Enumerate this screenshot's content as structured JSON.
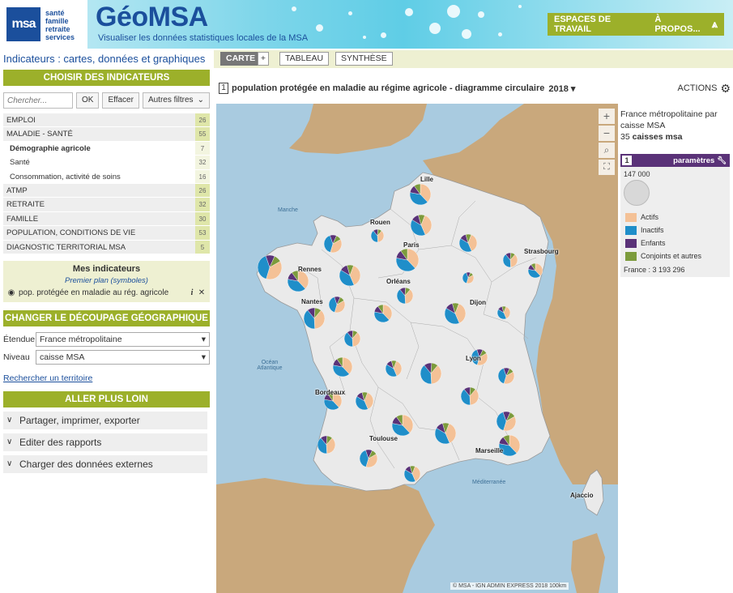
{
  "header": {
    "logo_text": "msa",
    "logo_lines": [
      "santé",
      "famille",
      "retraite",
      "services"
    ],
    "brand": "GéoMSA",
    "subtitle": "Visualiser les données statistiques locales de la MSA",
    "nav": {
      "workspaces": "ESPACES DE TRAVAIL",
      "about": "À PROPOS..."
    }
  },
  "left": {
    "title": "Indicateurs : cartes, données et graphiques",
    "choose_btn": "CHOISIR DES INDICATEURS",
    "search": {
      "placeholder": "Chercher...",
      "ok": "OK",
      "clear": "Effacer",
      "filters": "Autres filtres"
    },
    "indicators": [
      {
        "label": "EMPLOI",
        "count": "26",
        "kind": "cat"
      },
      {
        "label": "MALADIE - SANTÉ",
        "count": "55",
        "kind": "cat"
      },
      {
        "label": "Démographie agricole",
        "count": "7",
        "kind": "sub-bold"
      },
      {
        "label": "Santé",
        "count": "32",
        "kind": "sub"
      },
      {
        "label": "Consommation, activité de soins",
        "count": "16",
        "kind": "sub"
      },
      {
        "label": "ATMP",
        "count": "26",
        "kind": "cat"
      },
      {
        "label": "RETRAITE",
        "count": "32",
        "kind": "cat"
      },
      {
        "label": "FAMILLE",
        "count": "30",
        "kind": "cat"
      },
      {
        "label": "POPULATION, CONDITIONS DE VIE",
        "count": "53",
        "kind": "cat"
      },
      {
        "label": "DIAGNOSTIC TERRITORIAL MSA",
        "count": "5",
        "kind": "cat"
      }
    ],
    "my_indicators": {
      "title": "Mes indicateurs",
      "subtitle": "Premier plan (symboles)",
      "item": "pop. protégée en maladie au rég. agricole"
    },
    "geo_btn": "CHANGER LE DÉCOUPAGE GÉOGRAPHIQUE",
    "extent_label": "Étendue",
    "extent_value": "France métropolitaine",
    "level_label": "Niveau",
    "level_value": "caisse MSA",
    "search_territory": "Rechercher un territoire",
    "more_btn": "ALLER PLUS LOIN",
    "accordions": [
      "Partager, imprimer, exporter",
      "Editer des rapports",
      "Charger des données externes"
    ]
  },
  "toolbar": {
    "carte": "CARTE",
    "plus": "+",
    "tableau": "TABLEAU",
    "synthese": "SYNTHÈSE"
  },
  "map_header": {
    "number": "1",
    "title": "population protégée en maladie au régime agricole - diagramme circulaire",
    "year": "2018",
    "actions": "ACTIONS"
  },
  "map": {
    "zoom_in": "+",
    "zoom_out": "−",
    "cities": [
      "Lille",
      "Rouen",
      "Paris",
      "Strasbourg",
      "Rennes",
      "Orléans",
      "Nantes",
      "Dijon",
      "Lyon",
      "Bordeaux",
      "Toulouse",
      "Marseille",
      "Ajaccio"
    ],
    "seas": [
      "Manche",
      "Océan Atlantique",
      "Méditerranée"
    ],
    "attribution": "© MSA - IGN ADMIN EXPRESS 2018  100km"
  },
  "legend": {
    "title": "France métropolitaine par caisse MSA",
    "count_num": "35",
    "count_label": "caisses msa",
    "panel_number": "1",
    "panel_title": "paramètres",
    "total": "147 000",
    "france_total": "France : 3 193 296",
    "categories": [
      {
        "label": "Actifs",
        "color": "#f4c196"
      },
      {
        "label": "Inactifs",
        "color": "#1f8ec9"
      },
      {
        "label": "Enfants",
        "color": "#5a3278"
      },
      {
        "label": "Conjoints et autres",
        "color": "#7c9b3c"
      }
    ]
  }
}
